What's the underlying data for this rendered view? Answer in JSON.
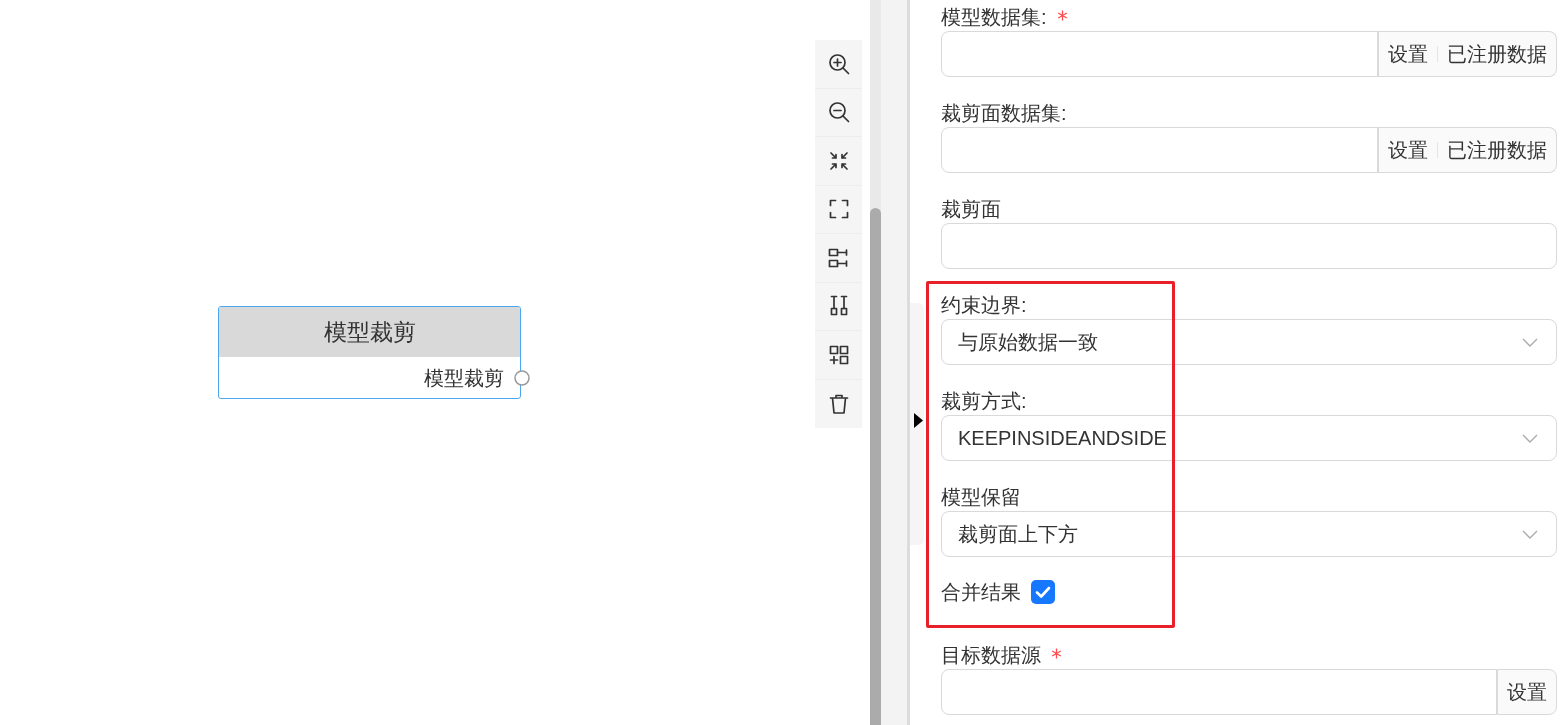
{
  "canvas": {
    "nodes": [
      {
        "title": "模型裁剪",
        "selected": true,
        "ports": [
          {
            "label": "模型裁剪"
          }
        ]
      }
    ]
  },
  "toolbar": {
    "buttons": [
      {
        "kind": "zoom-in"
      },
      {
        "kind": "zoom-out"
      },
      {
        "kind": "fit"
      },
      {
        "kind": "fullscreen"
      },
      {
        "kind": "align-rows"
      },
      {
        "kind": "align-columns"
      },
      {
        "kind": "add-grid"
      },
      {
        "kind": "delete"
      }
    ]
  },
  "form": {
    "fields": [
      {
        "kind": "input",
        "label": "模型数据集:",
        "required": true,
        "highlighted": false,
        "buttons": [
          "设置",
          "已注册数据"
        ]
      },
      {
        "kind": "input",
        "label": "裁剪面数据集:",
        "required": false,
        "highlighted": false,
        "buttons": [
          "设置",
          "已注册数据"
        ]
      },
      {
        "kind": "input",
        "label": "裁剪面",
        "required": false,
        "highlighted": false
      },
      {
        "kind": "select",
        "label": "约束边界:",
        "value": "与原始数据一致",
        "required": false,
        "highlighted": true
      },
      {
        "kind": "select",
        "label": "裁剪方式:",
        "value": "KEEPINSIDEANDSIDE",
        "required": false,
        "highlighted": true
      },
      {
        "kind": "select",
        "label": "模型保留",
        "value": "裁剪面上下方",
        "required": false,
        "highlighted": true
      },
      {
        "kind": "checkbox",
        "label": "合并结果",
        "checked": true,
        "required": false,
        "highlighted": true
      },
      {
        "kind": "input",
        "label": "目标数据源",
        "required": true,
        "highlighted": false,
        "buttons": [
          "设置"
        ]
      }
    ]
  }
}
